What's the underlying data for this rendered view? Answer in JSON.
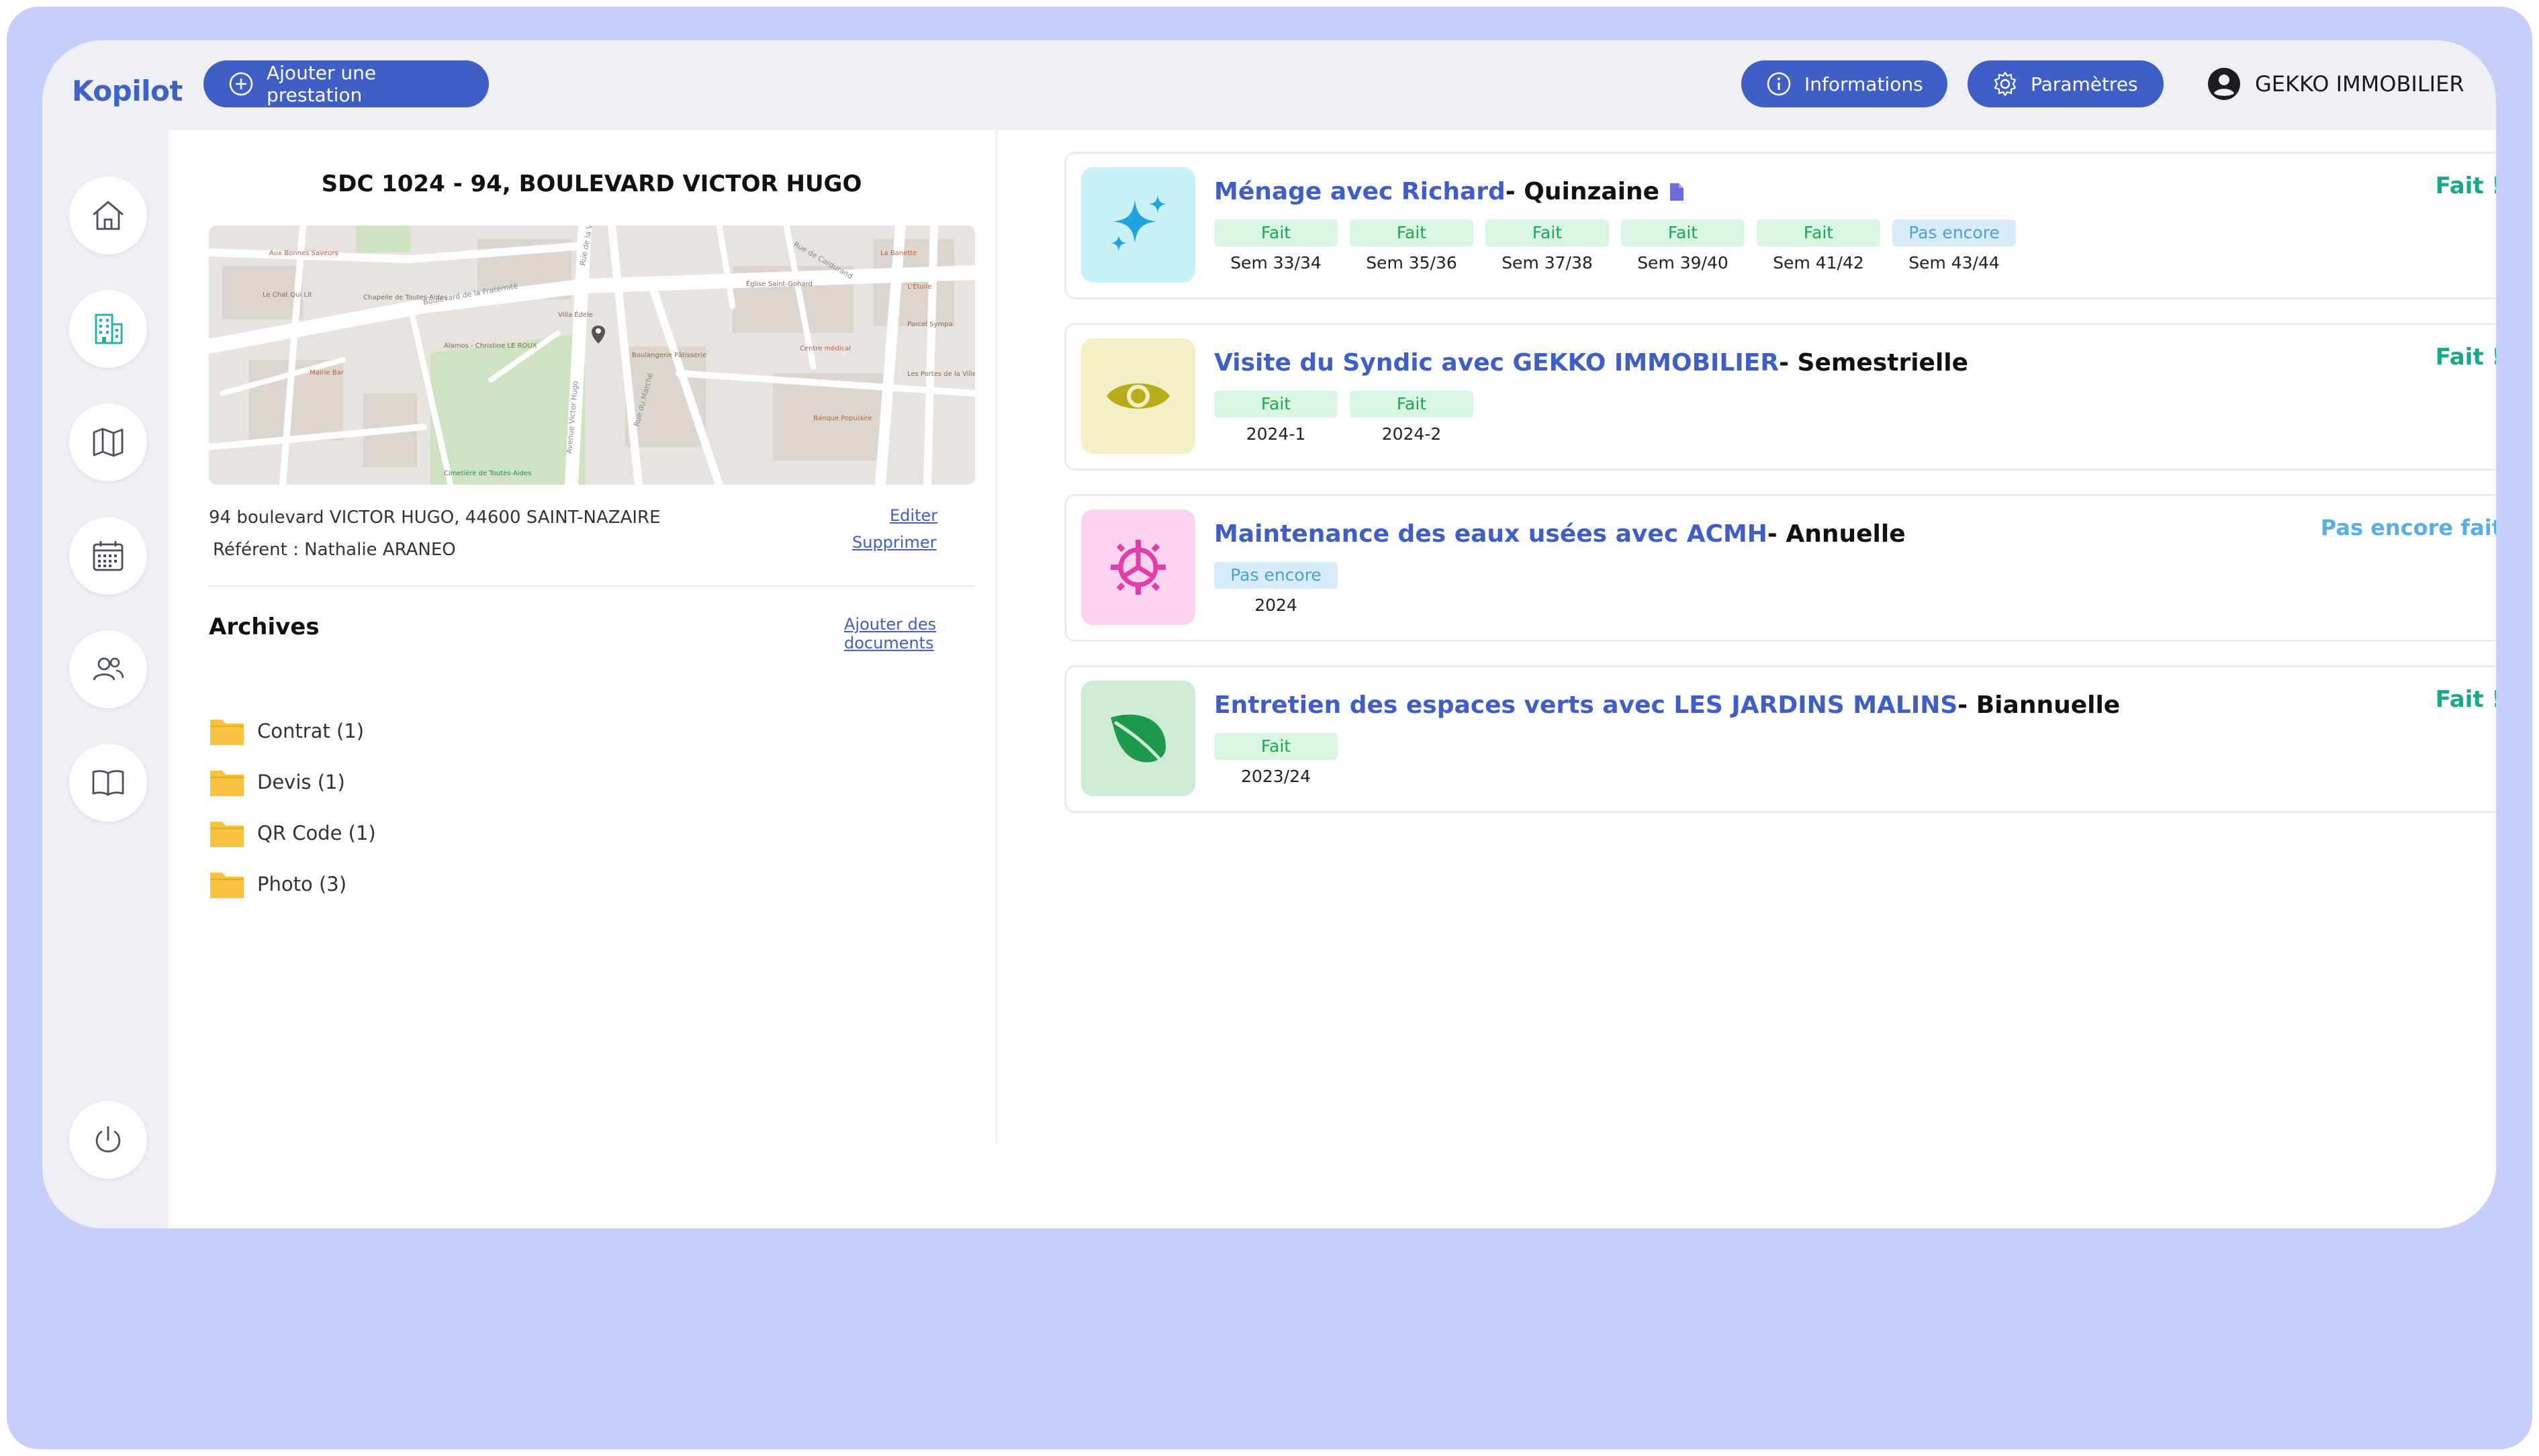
{
  "app": {
    "name": "Kopilot"
  },
  "header": {
    "add_label": "Ajouter une prestation",
    "info_label": "Informations",
    "params_label": "Paramètres",
    "user_name": "GEKKO IMMOBILIER"
  },
  "sidebar": {
    "items": [
      "home-icon",
      "building-icon",
      "map-icon",
      "calendar-icon",
      "users-icon",
      "book-icon"
    ],
    "logout": "power-icon"
  },
  "property": {
    "title": "SDC 1024 - 94, BOULEVARD VICTOR HUGO",
    "address": "94 boulevard VICTOR HUGO, 44600 SAINT-NAZAIRE",
    "referent": "Référent : Nathalie ARANEO",
    "edit_label": "Editer",
    "delete_label": "Supprimer"
  },
  "map": {
    "streets": [
      "Boulevard de la Fraternité",
      "Avenue Victor Hugo",
      "Rue du Marché",
      "Rue de la Ville",
      "Rue de Cardurand"
    ],
    "places": [
      "Aux Bonnes Saveurs",
      "Le Chat Qui Lit",
      "Chapelle de Toutes-Aides",
      "Villa Édele",
      "Église Saint-Gohard",
      "Boulangerie Pâtisserie",
      "Centre médical",
      "Banque Populaire",
      "Cimetière de Toutes-Aides",
      "Mairie Bar",
      "Alamos - Christine LE ROUX",
      "La Banette",
      "L'Étoile",
      "Parcel Sympa",
      "Les Portes de la Ville"
    ]
  },
  "archives": {
    "title": "Archives",
    "add_docs_label": "Ajouter des documents",
    "folders": [
      {
        "label": "Contrat (1)"
      },
      {
        "label": "Devis (1)"
      },
      {
        "label": "QR Code (1)"
      },
      {
        "label": "Photo (3)"
      }
    ]
  },
  "services": [
    {
      "title_blue": "Ménage avec Richard",
      "title_rest": "- Quinzaine",
      "status": "Fait !",
      "icon": "sparkles-icon",
      "icon_bg": "#c9f1f8",
      "badges": [
        {
          "tag": "Fait",
          "period": "Sem 33/34"
        },
        {
          "tag": "Fait",
          "period": "Sem 35/36"
        },
        {
          "tag": "Fait",
          "period": "Sem 37/38"
        },
        {
          "tag": "Fait",
          "period": "Sem 39/40"
        },
        {
          "tag": "Fait",
          "period": "Sem 41/42"
        },
        {
          "tag": "Pas encore",
          "period": "Sem 43/44"
        }
      ]
    },
    {
      "title_blue": "Visite du Syndic avec GEKKO IMMOBILIER",
      "title_rest": "- Semestrielle",
      "status": "Fait !",
      "icon": "eye-icon",
      "icon_bg": "#f3f0c7",
      "badges": [
        {
          "tag": "Fait",
          "period": "2024-1"
        },
        {
          "tag": "Fait",
          "period": "2024-2"
        }
      ]
    },
    {
      "title_blue": "Maintenance des eaux usées avec ACMH",
      "title_rest": "- Annuelle",
      "status": "Pas encore fait",
      "icon": "pipe-gear-icon",
      "icon_bg": "#fcd3ee",
      "badges": [
        {
          "tag": "Pas encore",
          "period": "2024"
        }
      ]
    },
    {
      "title_blue": "Entretien des espaces verts avec LES JARDINS MALINS",
      "title_rest": "- Biannuelle",
      "status": "Fait !",
      "icon": "leaf-icon",
      "icon_bg": "#cdebd5",
      "badges": [
        {
          "tag": "Fait",
          "period": "2023/24"
        }
      ]
    }
  ],
  "colors": {
    "accent": "#3f5fc6",
    "done": "#1aa88a",
    "pending": "#5aaee6",
    "background": "#c5cffa"
  }
}
